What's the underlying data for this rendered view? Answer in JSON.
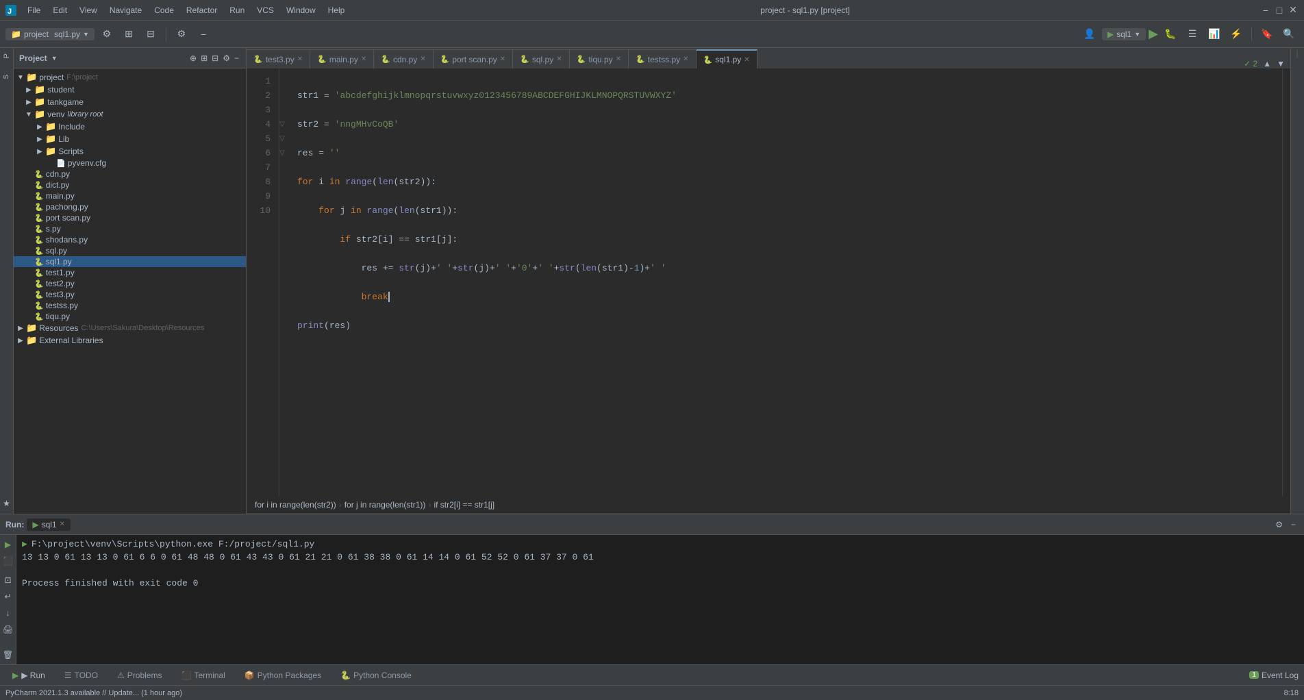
{
  "titlebar": {
    "menus": [
      "File",
      "Edit",
      "View",
      "Navigate",
      "Code",
      "Refactor",
      "Run",
      "VCS",
      "Window",
      "Help"
    ],
    "title": "project - sql1.py [project]",
    "minimize": "−",
    "maximize": "□",
    "close": "✕"
  },
  "toolbar": {
    "project_label": "project",
    "file_label": "sql1.py",
    "run_config": "sql1",
    "run_btn": "▶",
    "debug_btn": "🐛"
  },
  "project_panel": {
    "title": "Project",
    "root": "project",
    "root_path": "F:\\project",
    "items": [
      {
        "level": 1,
        "type": "folder",
        "name": "student",
        "expanded": false
      },
      {
        "level": 1,
        "type": "folder",
        "name": "tankgame",
        "expanded": false
      },
      {
        "level": 1,
        "type": "folder",
        "name": "venv",
        "suffix": "library root",
        "expanded": true
      },
      {
        "level": 2,
        "type": "folder",
        "name": "Include",
        "expanded": false
      },
      {
        "level": 2,
        "type": "folder",
        "name": "Lib",
        "expanded": false
      },
      {
        "level": 2,
        "type": "folder",
        "name": "Scripts",
        "expanded": false
      },
      {
        "level": 3,
        "type": "cfg",
        "name": "pyvenv.cfg"
      },
      {
        "level": 1,
        "type": "py",
        "name": "cdn.py"
      },
      {
        "level": 1,
        "type": "py",
        "name": "dict.py"
      },
      {
        "level": 1,
        "type": "py",
        "name": "main.py"
      },
      {
        "level": 1,
        "type": "py",
        "name": "pachong.py"
      },
      {
        "level": 1,
        "type": "py",
        "name": "port scan.py"
      },
      {
        "level": 1,
        "type": "py",
        "name": "s.py"
      },
      {
        "level": 1,
        "type": "py",
        "name": "shodans.py"
      },
      {
        "level": 1,
        "type": "py",
        "name": "sql.py"
      },
      {
        "level": 1,
        "type": "py",
        "name": "sql1.py",
        "active": true
      },
      {
        "level": 1,
        "type": "py",
        "name": "test1.py"
      },
      {
        "level": 1,
        "type": "py",
        "name": "test2.py"
      },
      {
        "level": 1,
        "type": "py",
        "name": "test3.py"
      },
      {
        "level": 1,
        "type": "py",
        "name": "testss.py"
      },
      {
        "level": 1,
        "type": "py",
        "name": "tiqu.py"
      },
      {
        "level": 0,
        "type": "folder",
        "name": "Resources",
        "path": "C:\\Users\\Sakura\\Desktop\\Resources",
        "expanded": false
      },
      {
        "level": 0,
        "type": "folder",
        "name": "External Libraries",
        "expanded": false
      }
    ]
  },
  "tabs": [
    {
      "name": "test3.py",
      "active": false,
      "icon": "🐍"
    },
    {
      "name": "main.py",
      "active": false,
      "icon": "🐍"
    },
    {
      "name": "cdn.py",
      "active": false,
      "icon": "🐍"
    },
    {
      "name": "port scan.py",
      "active": false,
      "icon": "🐍"
    },
    {
      "name": "sql.py",
      "active": false,
      "icon": "🐍"
    },
    {
      "name": "tiqu.py",
      "active": false,
      "icon": "🐍"
    },
    {
      "name": "testss.py",
      "active": false,
      "icon": "🐍"
    },
    {
      "name": "sql1.py",
      "active": true,
      "icon": "🐍"
    }
  ],
  "code": {
    "lines": [
      {
        "num": 1,
        "content": "str1 = 'abcdefghijklmnopqrstuvwxyz0123456789ABCDEFGHIJKLMNOPQRSTUVWXYZ'"
      },
      {
        "num": 2,
        "content": "str2 = 'nngMHvCoQB'"
      },
      {
        "num": 3,
        "content": "res = ''"
      },
      {
        "num": 4,
        "content": "for i in range(len(str2)):"
      },
      {
        "num": 5,
        "content": "    for j in range(len(str1)):"
      },
      {
        "num": 6,
        "content": "        if str2[i] == str1[j]:"
      },
      {
        "num": 7,
        "content": "            res += str(j)+' '+str(j)+' '+'0'+' '+str(len(str1)-1)+' '"
      },
      {
        "num": 8,
        "content": "            break"
      },
      {
        "num": 9,
        "content": "print(res)"
      },
      {
        "num": 10,
        "content": ""
      }
    ]
  },
  "breadcrumb": {
    "items": [
      "for i in range(len(str2))",
      "for j in range(len(str1))",
      "if str2[i] == str1[j]"
    ]
  },
  "run_panel": {
    "tab_label": "Run:",
    "config_name": "sql1",
    "command": "F:\\project\\venv\\Scripts\\python.exe F:/project/sql1.py",
    "output_line1": "13 13 0 61 13 13 0 61 6 6 0 61 48 48 0 61 43 43 0 61 21 21 0 61 38 38 0 61 14 14 0 61 52 52 0 61 37 37 0 61",
    "output_line2": "",
    "exit_message": "Process finished with exit code 0"
  },
  "bottom_toolbar": {
    "tabs": [
      {
        "label": "▶  Run",
        "active": false
      },
      {
        "label": "☰  TODO",
        "active": false
      },
      {
        "label": "⚠  Problems",
        "active": false
      },
      {
        "label": "Terminal",
        "active": false
      },
      {
        "label": "Python Packages",
        "active": false
      },
      {
        "label": "Python Console",
        "active": false
      }
    ],
    "right": "Event Log",
    "event_count": "1"
  },
  "status_bar": {
    "update_msg": "PyCharm 2021.1.3 available // Update... (1 hour ago)",
    "right": {
      "line_col": "8:18"
    }
  }
}
